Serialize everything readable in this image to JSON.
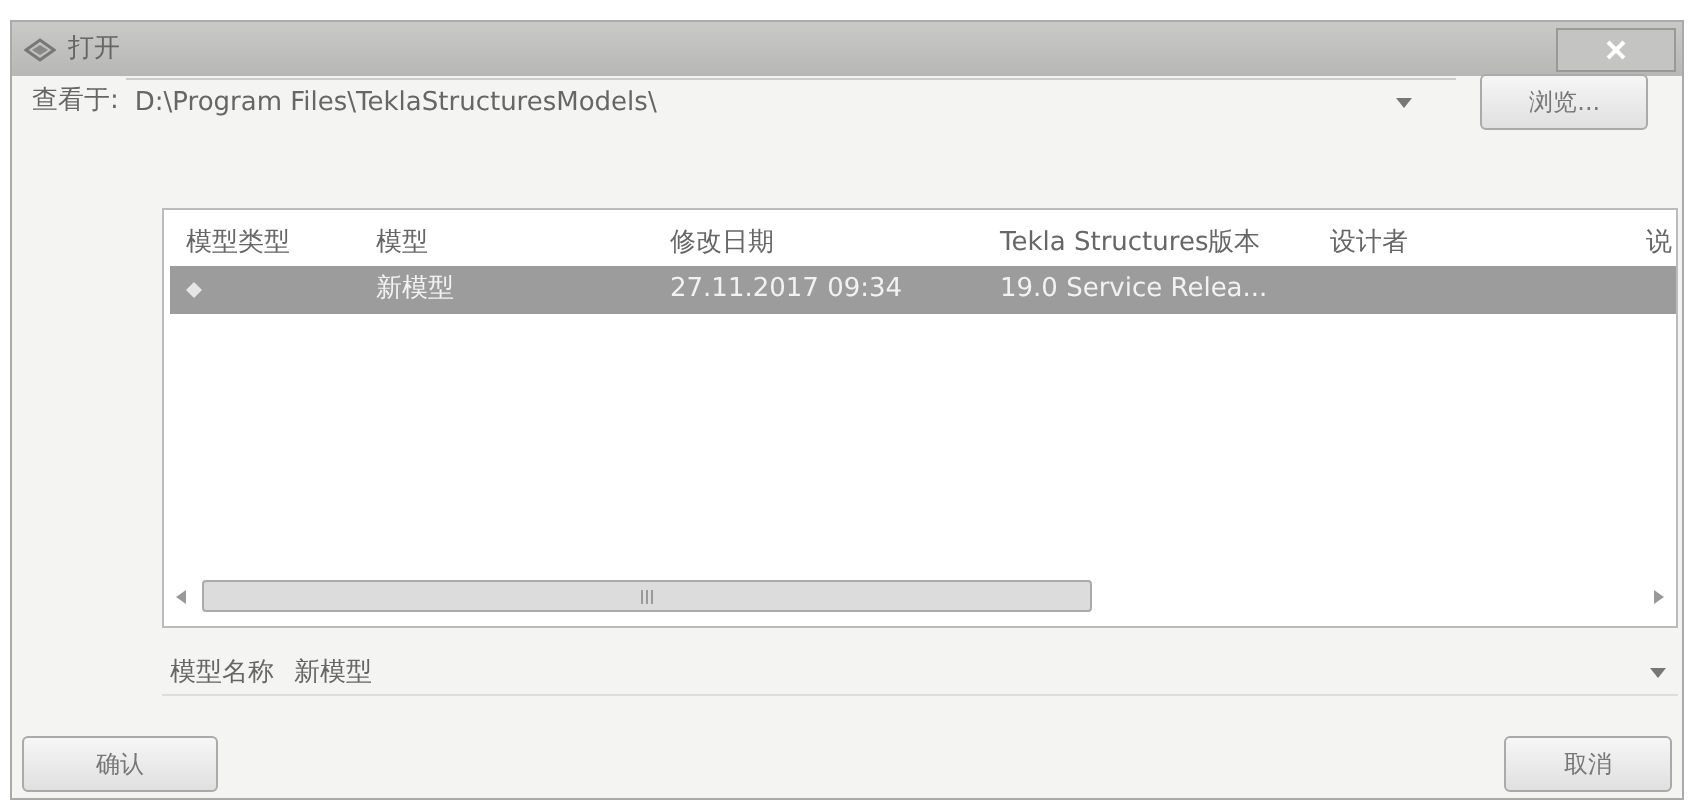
{
  "window": {
    "title": "打开"
  },
  "look_in": {
    "label": "查看于:",
    "value": "D:\\Program Files\\TeklaStructuresModels\\"
  },
  "browse_button": "浏览...",
  "table": {
    "columns": [
      "模型类型",
      "模型",
      "修改日期",
      "Tekla Structures版本",
      "设计者",
      "说"
    ],
    "rows": [
      {
        "selected": true,
        "model": "新模型",
        "modified": "27.11.2017 09:34",
        "version": "19.0 Service Relea..."
      }
    ]
  },
  "model_name": {
    "label": "模型名称",
    "value": "新模型"
  },
  "buttons": {
    "ok": "确认",
    "cancel": "取消"
  }
}
